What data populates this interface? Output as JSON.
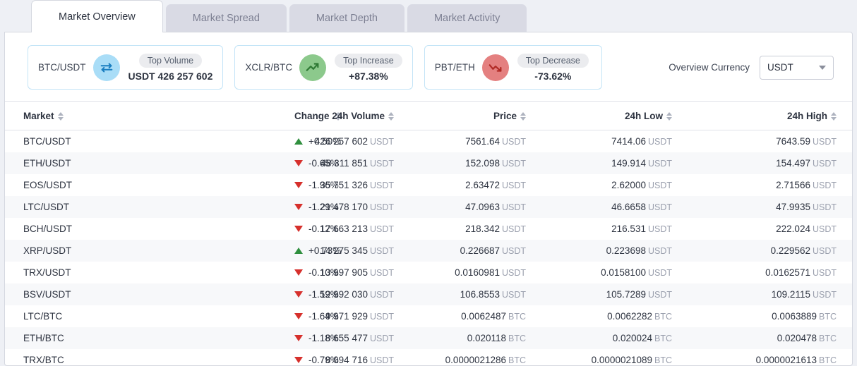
{
  "tabs": [
    {
      "label": "Market Overview",
      "active": true
    },
    {
      "label": "Market Spread",
      "active": false
    },
    {
      "label": "Market Depth",
      "active": false
    },
    {
      "label": "Market Activity",
      "active": false
    }
  ],
  "summary_cards": [
    {
      "pair": "BTC/USDT",
      "icon": "exchange-arrows-icon",
      "icon_color": "#a9ddf7",
      "badge": "Top Volume",
      "value": "USDT 426 257 602"
    },
    {
      "pair": "XCLR/BTC",
      "icon": "trending-up-icon",
      "icon_color": "#8cc98c",
      "badge": "Top Increase",
      "value": "+87.38%"
    },
    {
      "pair": "PBT/ETH",
      "icon": "trending-down-icon",
      "icon_color": "#e48080",
      "badge": "Top Decrease",
      "value": "-73.62%"
    }
  ],
  "overview_currency": {
    "label": "Overview Currency",
    "selected": "USDT"
  },
  "table": {
    "columns": [
      {
        "label": "Market",
        "sortable": true
      },
      {
        "label": "Change",
        "sortable": true
      },
      {
        "label": "24h Volume",
        "sortable": true
      },
      {
        "label": "Price",
        "sortable": true
      },
      {
        "label": "24h Low",
        "sortable": true
      },
      {
        "label": "24h High",
        "sortable": true
      }
    ],
    "rows": [
      {
        "market": "BTC/USDT",
        "direction": "up",
        "change": "+0.50%",
        "volume": "426 257 602",
        "volume_cur": "USDT",
        "price": "7561.64",
        "price_cur": "USDT",
        "low": "7414.06",
        "low_cur": "USDT",
        "high": "7643.59",
        "high_cur": "USDT"
      },
      {
        "market": "ETH/USDT",
        "direction": "down",
        "change": "-0.65%",
        "volume": "48 311 851",
        "volume_cur": "USDT",
        "price": "152.098",
        "price_cur": "USDT",
        "low": "149.914",
        "low_cur": "USDT",
        "high": "154.497",
        "high_cur": "USDT"
      },
      {
        "market": "EOS/USDT",
        "direction": "down",
        "change": "-1.96%",
        "volume": "35 751 326",
        "volume_cur": "USDT",
        "price": "2.63472",
        "price_cur": "USDT",
        "low": "2.62000",
        "low_cur": "USDT",
        "high": "2.71566",
        "high_cur": "USDT"
      },
      {
        "market": "LTC/USDT",
        "direction": "down",
        "change": "-1.29%",
        "volume": "21 478 170",
        "volume_cur": "USDT",
        "price": "47.0963",
        "price_cur": "USDT",
        "low": "46.6658",
        "low_cur": "USDT",
        "high": "47.9935",
        "high_cur": "USDT"
      },
      {
        "market": "BCH/USDT",
        "direction": "down",
        "change": "-0.12%",
        "volume": "17 663 213",
        "volume_cur": "USDT",
        "price": "218.342",
        "price_cur": "USDT",
        "low": "216.531",
        "low_cur": "USDT",
        "high": "222.024",
        "high_cur": "USDT"
      },
      {
        "market": "XRP/USDT",
        "direction": "up",
        "change": "+0.73%",
        "volume": "14 275 345",
        "volume_cur": "USDT",
        "price": "0.226687",
        "price_cur": "USDT",
        "low": "0.223698",
        "low_cur": "USDT",
        "high": "0.229562",
        "high_cur": "USDT"
      },
      {
        "market": "TRX/USDT",
        "direction": "down",
        "change": "-0.10%",
        "volume": "13 997 905",
        "volume_cur": "USDT",
        "price": "0.0160981",
        "price_cur": "USDT",
        "low": "0.0158100",
        "low_cur": "USDT",
        "high": "0.0162571",
        "high_cur": "USDT"
      },
      {
        "market": "BSV/USDT",
        "direction": "down",
        "change": "-1.59%",
        "volume": "12 992 030",
        "volume_cur": "USDT",
        "price": "106.8553",
        "price_cur": "USDT",
        "low": "105.7289",
        "low_cur": "USDT",
        "high": "109.2115",
        "high_cur": "USDT"
      },
      {
        "market": "LTC/BTC",
        "direction": "down",
        "change": "-1.64%",
        "volume": "9 971 929",
        "volume_cur": "USDT",
        "price": "0.0062487",
        "price_cur": "BTC",
        "low": "0.0062282",
        "low_cur": "BTC",
        "high": "0.0063889",
        "high_cur": "BTC"
      },
      {
        "market": "ETH/BTC",
        "direction": "down",
        "change": "-1.18%",
        "volume": "8 655 477",
        "volume_cur": "USDT",
        "price": "0.020118",
        "price_cur": "BTC",
        "low": "0.020024",
        "low_cur": "BTC",
        "high": "0.020478",
        "high_cur": "BTC"
      },
      {
        "market": "TRX/BTC",
        "direction": "down",
        "change": "-0.79%",
        "volume": "8 094 716",
        "volume_cur": "USDT",
        "price": "0.0000021286",
        "price_cur": "BTC",
        "low": "0.0000021089",
        "low_cur": "BTC",
        "high": "0.0000021613",
        "high_cur": "BTC"
      }
    ]
  },
  "colors": {
    "up": "#2f8f3e",
    "down": "#d6302c",
    "page_bg": "#eef0f5",
    "card_border": "#c3e4f7"
  }
}
